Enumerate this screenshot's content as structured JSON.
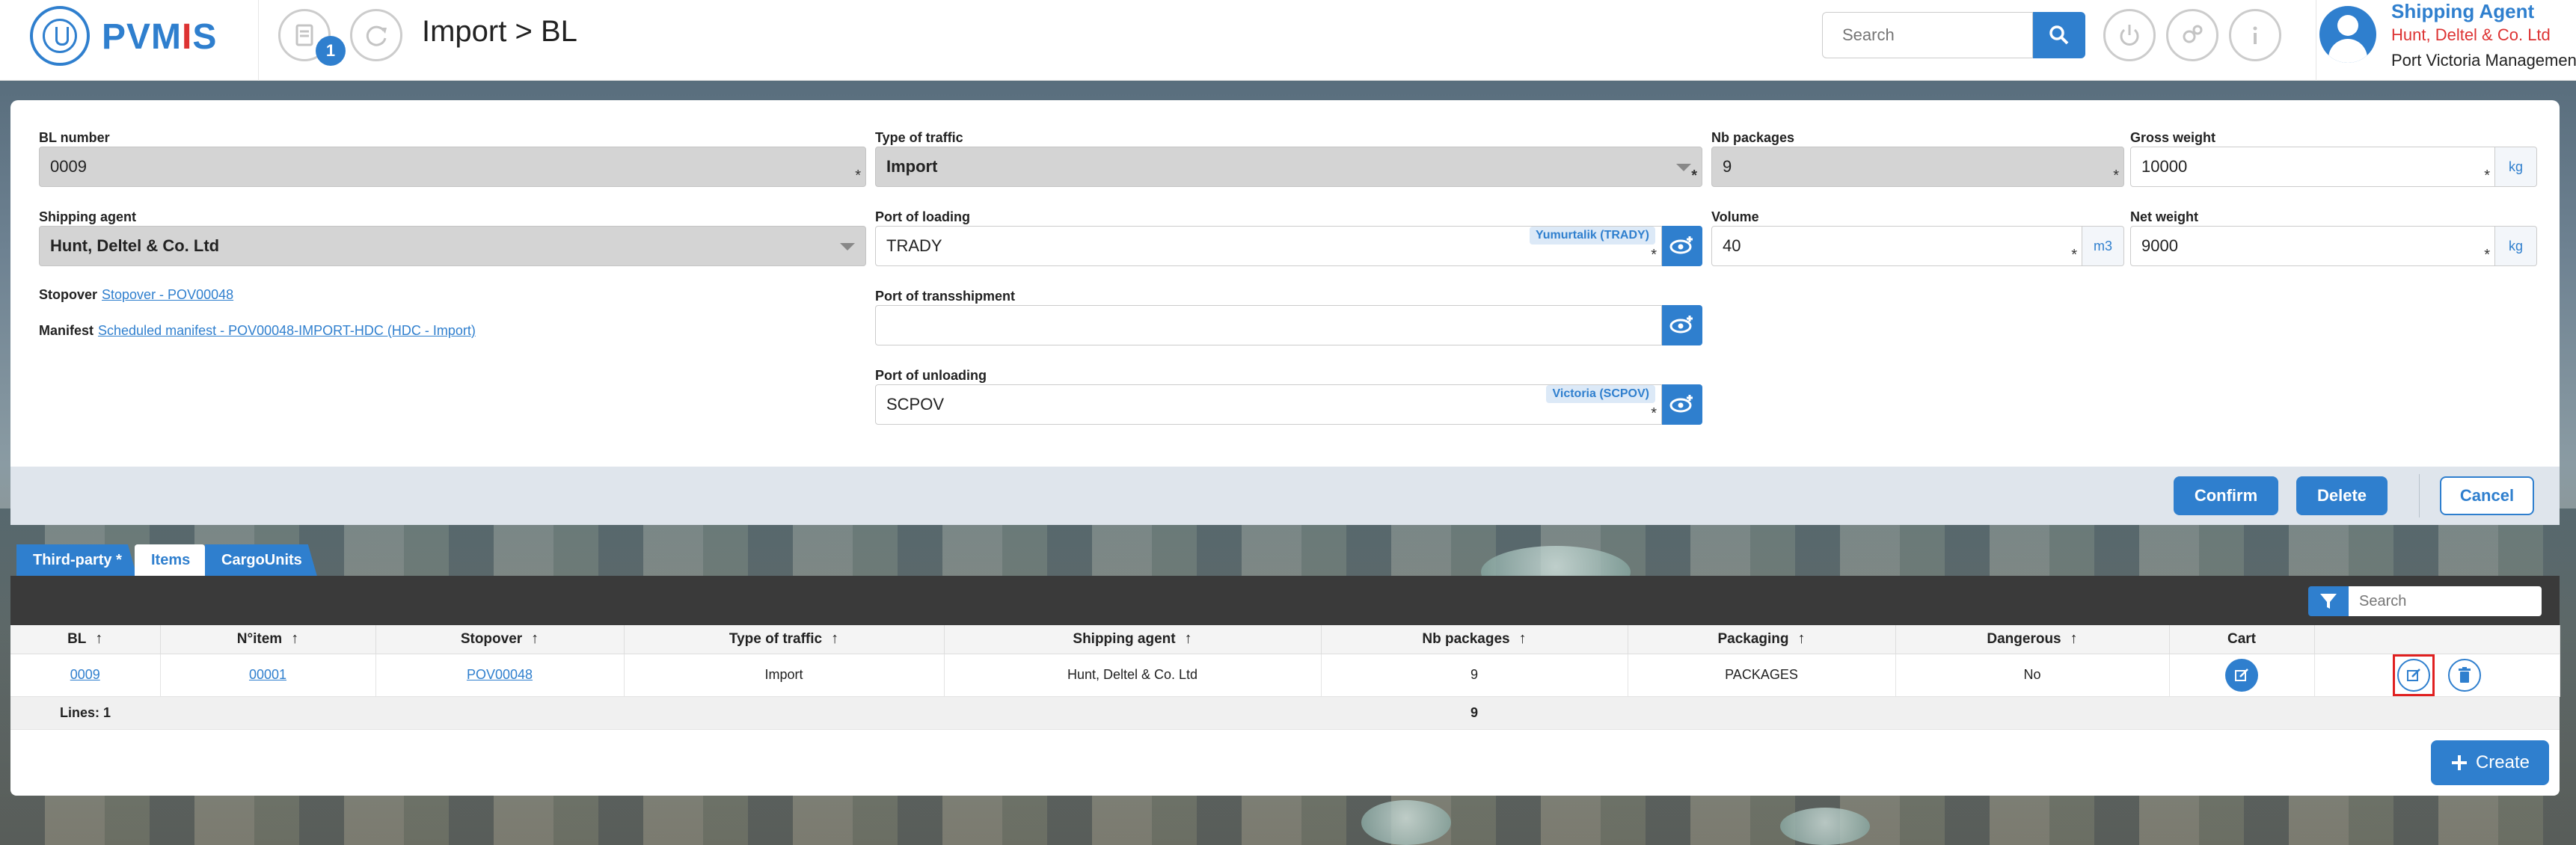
{
  "header": {
    "logo_text_a": "PVM",
    "logo_text_i": "I",
    "logo_text_b": "S",
    "notification_count": "1",
    "title": "Import > BL",
    "search_placeholder": "Search",
    "user": {
      "role": "Shipping Agent",
      "agent": "Hunt, Deltel & Co. Ltd",
      "port": "Port Victoria Management"
    }
  },
  "form": {
    "bl_number": {
      "label": "BL number",
      "value": "0009"
    },
    "type_of_traffic": {
      "label": "Type of traffic",
      "value": "Import"
    },
    "nb_packages": {
      "label": "Nb packages",
      "value": "9"
    },
    "gross_weight": {
      "label": "Gross weight",
      "value": "10000",
      "unit": "kg"
    },
    "shipping_agent": {
      "label": "Shipping agent",
      "value": "Hunt, Deltel & Co. Ltd"
    },
    "port_of_loading": {
      "label": "Port of loading",
      "value": "TRADY",
      "chip": "Yumurtalik (TRADY)"
    },
    "volume": {
      "label": "Volume",
      "value": "40",
      "unit": "m3"
    },
    "net_weight": {
      "label": "Net weight",
      "value": "9000",
      "unit": "kg"
    },
    "stopover": {
      "label": "Stopover",
      "link": "Stopover - POV00048"
    },
    "manifest": {
      "label": "Manifest",
      "link": "Scheduled manifest - POV00048-IMPORT-HDC (HDC - Import)"
    },
    "port_of_transshipment": {
      "label": "Port of transshipment",
      "value": ""
    },
    "port_of_unloading": {
      "label": "Port of unloading",
      "value": "SCPOV",
      "chip": "Victoria (SCPOV)"
    },
    "required_marker": "*"
  },
  "actions": {
    "confirm": "Confirm",
    "delete": "Delete",
    "cancel": "Cancel"
  },
  "tabs": [
    {
      "label": "Third-party *",
      "active": false
    },
    {
      "label": "Items",
      "active": true
    },
    {
      "label": "CargoUnits",
      "active": false
    }
  ],
  "grid": {
    "search_placeholder": "Search",
    "columns": [
      "BL",
      "N°item",
      "Stopover",
      "Type of traffic",
      "Shipping agent",
      "Nb packages",
      "Packaging",
      "Dangerous",
      "Cart",
      ""
    ],
    "sort_arrow": "↑",
    "rows": [
      {
        "bl": "0009",
        "item": "00001",
        "stopover": "POV00048",
        "traffic": "Import",
        "agent": "Hunt, Deltel & Co. Ltd",
        "packages": "9",
        "packaging": "PACKAGES",
        "dangerous": "No"
      }
    ],
    "footer": {
      "lines": "Lines: 1",
      "packages_total": "9"
    }
  },
  "create_label": "Create",
  "colors": {
    "accent": "#2f7fce",
    "danger_text": "#d33",
    "highlight": "#e02020"
  }
}
